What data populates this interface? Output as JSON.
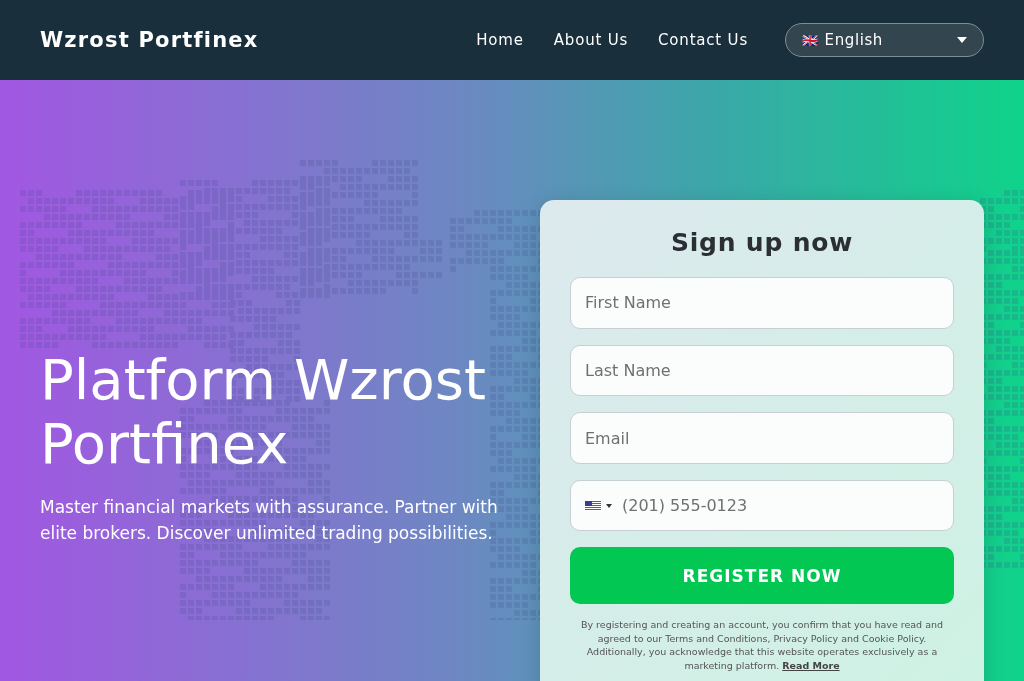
{
  "header": {
    "logo": "Wzrost Portfinex",
    "nav": [
      {
        "label": "Home"
      },
      {
        "label": "About Us"
      },
      {
        "label": "Contact Us"
      }
    ],
    "language": {
      "flag": "🇬🇧",
      "value": "English"
    }
  },
  "hero": {
    "title": "Platform Wzrost Portfinex",
    "subtitle": "Master financial markets with assurance. Partner with elite brokers. Discover unlimited trading possibilities."
  },
  "signup": {
    "title": "Sign up now",
    "fields": [
      {
        "kind": "text",
        "placeholder": "First Name"
      },
      {
        "kind": "text",
        "placeholder": "Last Name"
      },
      {
        "kind": "text",
        "placeholder": "Email"
      },
      {
        "kind": "phone",
        "placeholder": "(201) 555-0123"
      }
    ],
    "button": "REGISTER NOW",
    "disclaimer": "By registering and creating an account, you confirm that you have read and agreed to our Terms and Conditions, Privacy Policy and Cookie Policy. Additionally, you acknowledge that this website operates exclusively as a marketing platform.",
    "read_more": "Read More"
  }
}
